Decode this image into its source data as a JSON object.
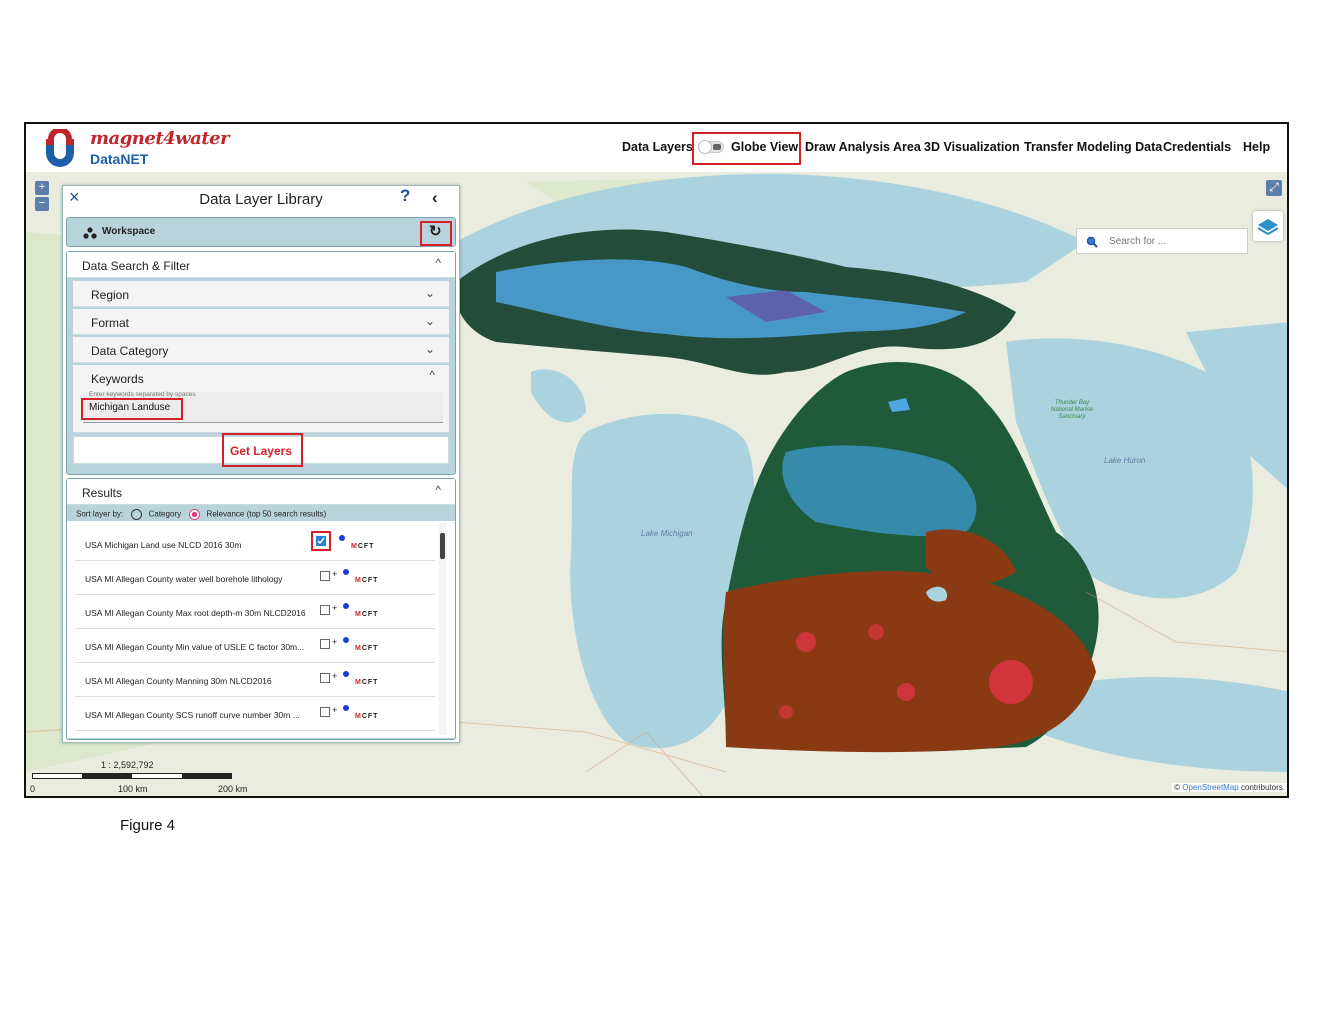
{
  "header": {
    "brand_name": "magnet4water",
    "brand_sub": "DataNET",
    "nav": {
      "data_layers": "Data Layers",
      "globe_view": "Globe View",
      "draw_analysis": "Draw Analysis Area",
      "visualization_3d": "3D Visualization",
      "transfer_modeling": "Transfer Modeling Data",
      "credentials": "Credentials",
      "help": "Help"
    },
    "globe_view_enabled": false
  },
  "panel": {
    "title": "Data Layer Library",
    "help_icon": "?",
    "collapse_icon": "‹",
    "close_icon": "×",
    "workspace": {
      "label": "Workspace",
      "refresh_icon": "↻"
    },
    "search_filter": {
      "label": "Data Search & Filter",
      "filters": [
        {
          "label": "Region",
          "expanded": false
        },
        {
          "label": "Format",
          "expanded": false
        },
        {
          "label": "Data Category",
          "expanded": false
        },
        {
          "label": "Keywords",
          "expanded": true
        }
      ],
      "keyword_hint": "Enter keywords separated by spaces",
      "keyword_value": "Michigan Landuse",
      "get_layers": "Get Layers"
    },
    "results": {
      "label": "Results",
      "sort_label": "Sort layer by:",
      "sort_options": [
        "Category",
        "Relevance (top 50 search results)"
      ],
      "sort_selected": "Relevance (top 50 search results)",
      "items": [
        {
          "name": "USA Michigan Land use NLCD 2016 30m",
          "checked": true,
          "tags": "MCFT"
        },
        {
          "name": "USA MI Allegan County water well borehole lithology",
          "checked": false,
          "tags": "MCFT"
        },
        {
          "name": "USA MI Allegan County Max root depth-m 30m NLCD2016",
          "checked": false,
          "tags": "MCFT"
        },
        {
          "name": "USA MI Allegan County Min value of USLE C factor 30m...",
          "checked": false,
          "tags": "MCFT"
        },
        {
          "name": "USA MI Allegan County Manning 30m NLCD2016",
          "checked": false,
          "tags": "MCFT"
        },
        {
          "name": "USA MI Allegan County SCS runoff curve number 30m ...",
          "checked": false,
          "tags": "MCFT"
        }
      ]
    }
  },
  "map": {
    "search_placeholder": "Search for ...",
    "zoom_in": "+",
    "zoom_out": "−",
    "fullscreen_icon": "⤢",
    "scale_ratio": "1 : 2,592,792",
    "scale_ticks": [
      "0",
      "100 km",
      "200 km"
    ],
    "attribution_prefix": "©",
    "attribution_link": "OpenStreetMap",
    "attribution_suffix": "contributors.",
    "labels": {
      "lake_michigan": "Lake Michigan",
      "lake_huron": "Lake Huron",
      "thunder_bay": "Thunder Bay National Marine Sanctuary"
    }
  },
  "caption": "Figure 4",
  "colors": {
    "accent_red": "#d61f26",
    "brand_blue": "#1d5fa8",
    "panel_teal": "#b8d3dc",
    "water": "#aad3df"
  }
}
